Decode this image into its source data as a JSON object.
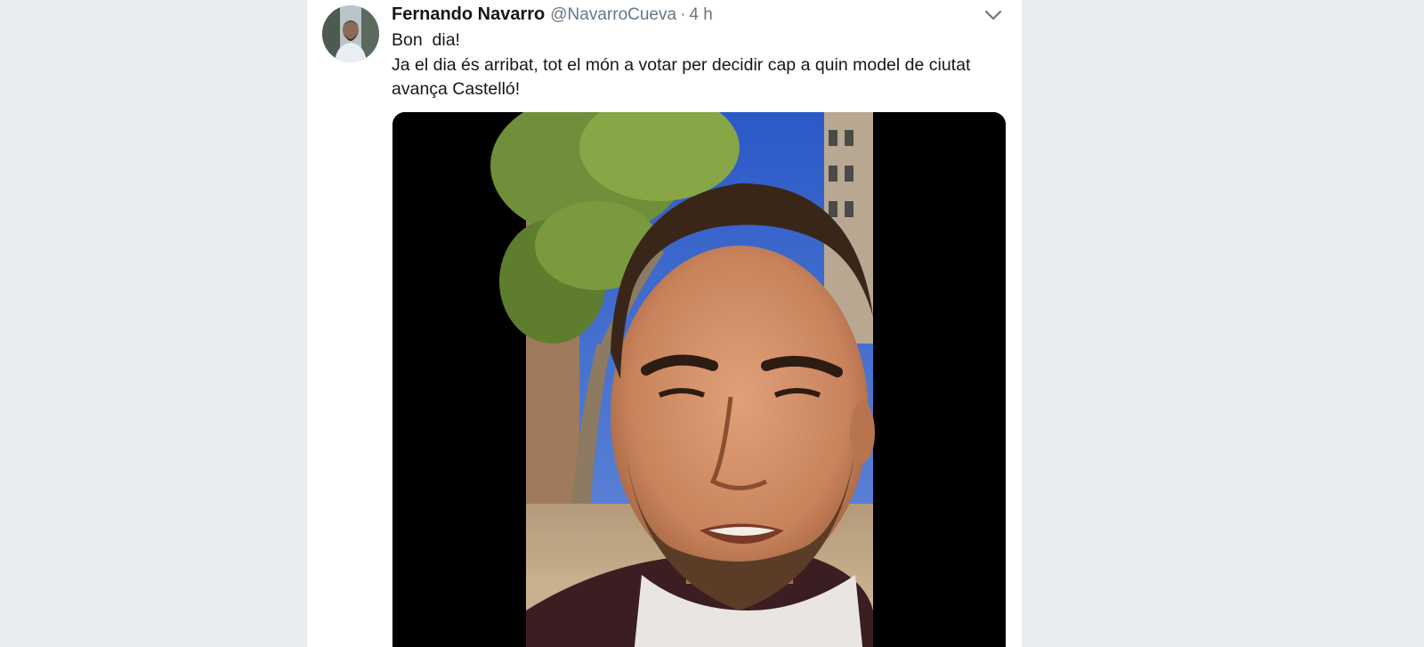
{
  "tweet": {
    "author_name": "Fernando Navarro",
    "author_handle": "@NavarroCueva",
    "separator": "·",
    "timestamp": "4 h",
    "text_lines": [
      "Bon  dia!",
      "Ja el dia és arribat, tot el món a votar per decidir cap a quin model de ciutat",
      "avança Castelló!"
    ]
  },
  "icons": {
    "menu": "chevron-down-icon"
  },
  "colors": {
    "background": "#e6ecf0",
    "card": "#ffffff",
    "name": "#14171a",
    "secondary": "#657786",
    "video_letterbox": "#000000"
  }
}
